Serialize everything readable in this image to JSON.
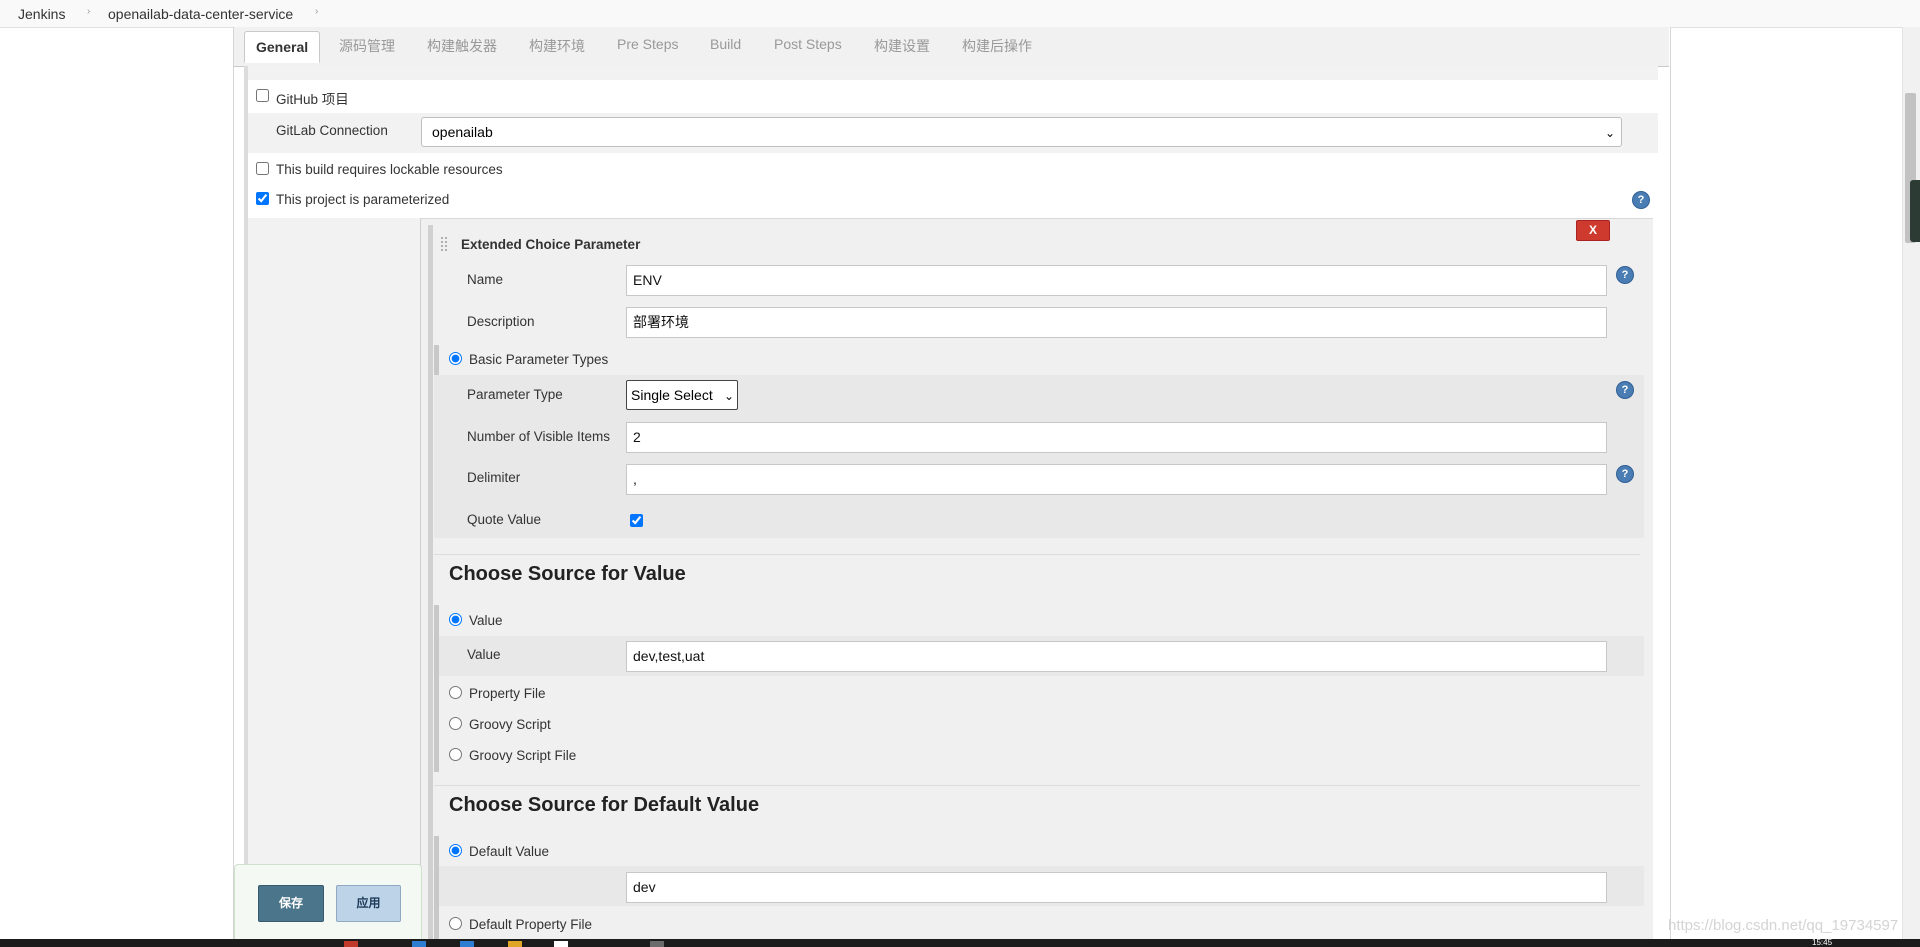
{
  "breadcrumb": [
    "Jenkins",
    "openailab-data-center-service"
  ],
  "tabs": [
    "General",
    "源码管理",
    "构建触发器",
    "构建环境",
    "Pre Steps",
    "Build",
    "Post Steps",
    "构建设置",
    "构建后操作"
  ],
  "general": {
    "github_project": {
      "label": "GitHub 项目",
      "checked": false
    },
    "gitlab_connection": {
      "label": "GitLab Connection",
      "value": "openailab"
    },
    "lockable_resources": {
      "label": "This build requires lockable resources",
      "checked": false
    },
    "parameterized": {
      "label": "This project is parameterized",
      "checked": true
    }
  },
  "parameter": {
    "title": "Extended Choice Parameter",
    "close_label": "X",
    "name_label": "Name",
    "name_value": "ENV",
    "description_label": "Description",
    "description_value": "部署环境",
    "basic_types_label": "Basic Parameter Types",
    "param_type_label": "Parameter Type",
    "param_type_value": "Single Select",
    "visible_items_label": "Number of Visible Items",
    "visible_items_value": "2",
    "delimiter_label": "Delimiter",
    "delimiter_value": ",",
    "quote_value_label": "Quote Value",
    "quote_value_checked": true
  },
  "source_value": {
    "heading": "Choose Source for Value",
    "value_option": "Value",
    "value_label": "Value",
    "value_value": "dev,test,uat",
    "property_file": "Property File",
    "groovy_script": "Groovy Script",
    "groovy_script_file": "Groovy Script File"
  },
  "source_default": {
    "heading": "Choose Source for Default Value",
    "default_option": "Default Value",
    "default_value": "dev",
    "default_property_file": "Default Property File"
  },
  "buttons": {
    "save": "保存",
    "apply": "应用"
  },
  "watermark": "https://blog.csdn.net/qq_19734597",
  "taskbar_time": "15:45",
  "colors": {
    "accent": "#4b758b",
    "close": "#cf3a2e",
    "help": "#4a7db3"
  }
}
